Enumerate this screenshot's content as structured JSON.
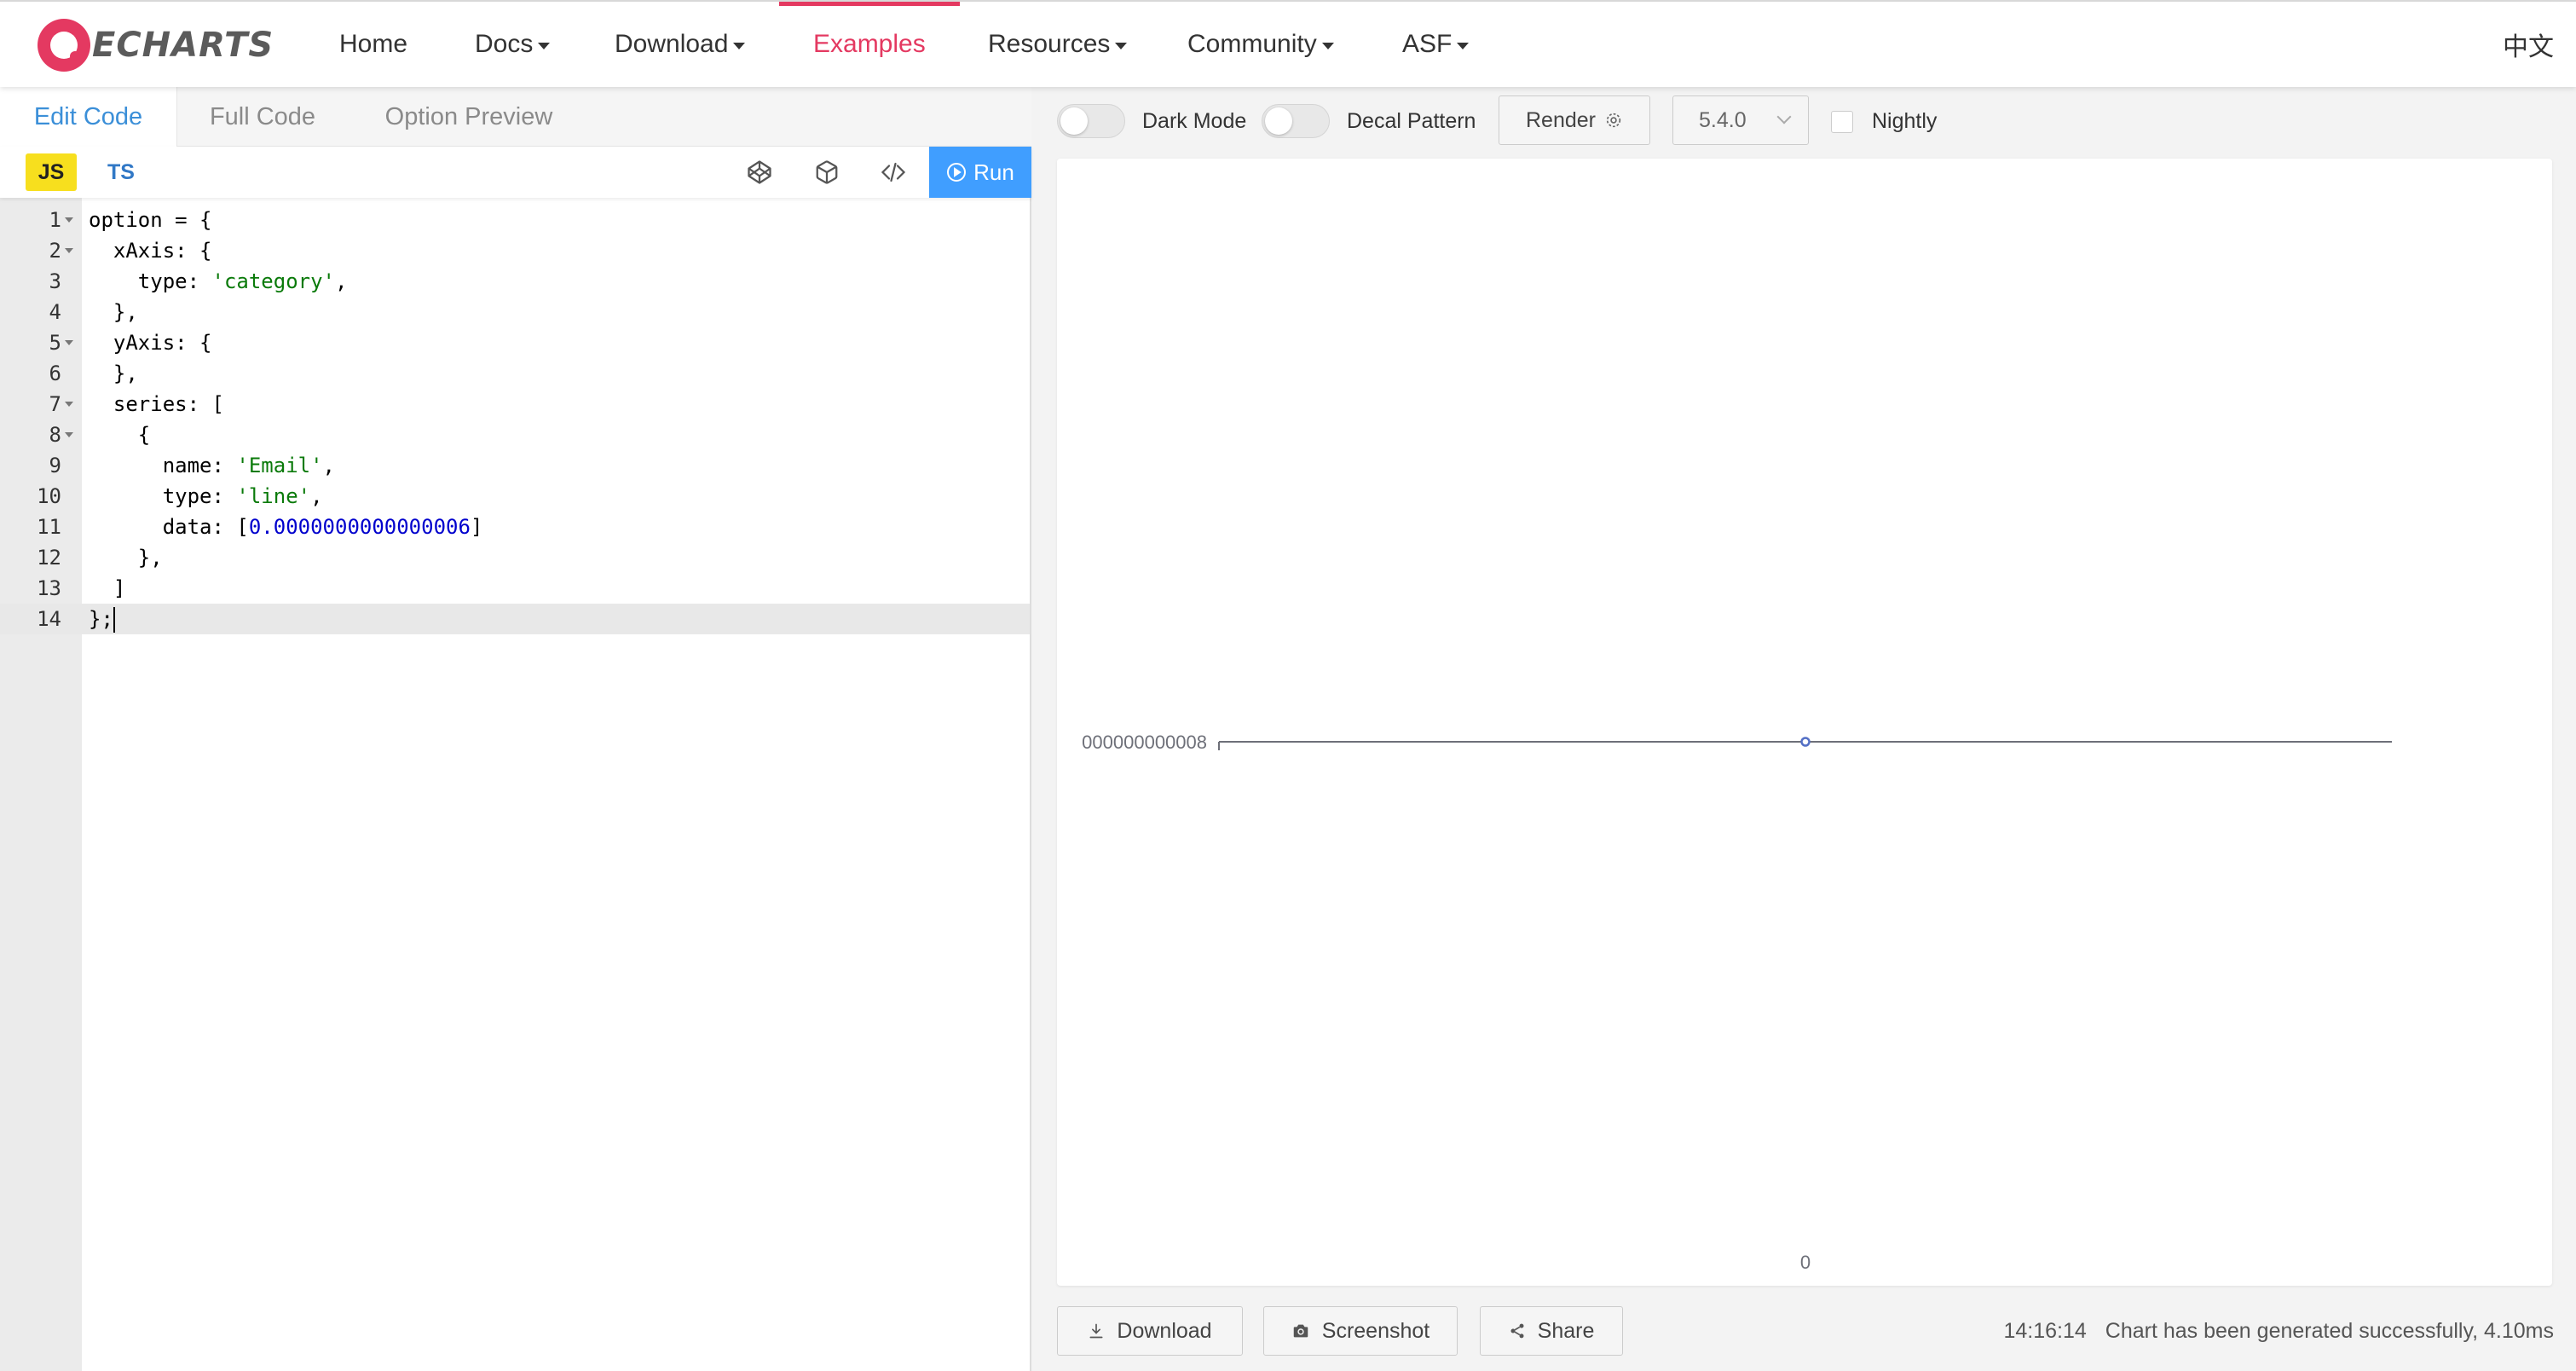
{
  "nav": {
    "logo_text": "ECHARTS",
    "items": [
      {
        "label": "Home"
      },
      {
        "label": "Docs"
      },
      {
        "label": "Download"
      },
      {
        "label": "Examples"
      },
      {
        "label": "Resources"
      },
      {
        "label": "Community"
      },
      {
        "label": "ASF"
      }
    ],
    "lang": "中文"
  },
  "editor": {
    "tabs": [
      {
        "label": "Edit Code"
      },
      {
        "label": "Full Code"
      },
      {
        "label": "Option Preview"
      }
    ],
    "lang_js": "JS",
    "lang_ts": "TS",
    "run_label": "Run",
    "tool_icons": [
      "codepen-icon",
      "codesandbox-icon",
      "embed-code-icon"
    ],
    "current_line": 14,
    "lines": [
      {
        "n": "1",
        "text": "option = {"
      },
      {
        "n": "2",
        "text": "  xAxis: {"
      },
      {
        "n": "3",
        "text": "    type: ",
        "str": "'category'",
        "after": ","
      },
      {
        "n": "4",
        "text": "  },"
      },
      {
        "n": "5",
        "text": "  yAxis: {"
      },
      {
        "n": "6",
        "text": "  },"
      },
      {
        "n": "7",
        "text": "  series: ["
      },
      {
        "n": "8",
        "text": "    {"
      },
      {
        "n": "9",
        "text": "      name: ",
        "str": "'Email'",
        "after": ","
      },
      {
        "n": "10",
        "text": "      type: ",
        "str": "'line'",
        "after": ","
      },
      {
        "n": "11",
        "text": "      data: [",
        "num": "0.0000000000000006",
        "after": "]"
      },
      {
        "n": "12",
        "text": "    },"
      },
      {
        "n": "13",
        "text": "  ]"
      },
      {
        "n": "14",
        "text": "};"
      }
    ]
  },
  "preview": {
    "dark_mode_label": "Dark Mode",
    "decal_label": "Decal Pattern",
    "render_label": "Render",
    "version": "5.4.0",
    "nightly_label": "Nightly",
    "download_label": "Download",
    "screenshot_label": "Screenshot",
    "share_label": "Share",
    "status_time": "14:16:14",
    "status_text": "Chart has been generated successfully, 4.10ms"
  },
  "chart_data": {
    "type": "line",
    "categories": [
      "0"
    ],
    "series": [
      {
        "name": "Email",
        "values": [
          6e-16
        ]
      }
    ],
    "y_tick_label": "000000000008",
    "colors": {
      "line": "#5470c6",
      "axis": "#6e7079"
    }
  }
}
